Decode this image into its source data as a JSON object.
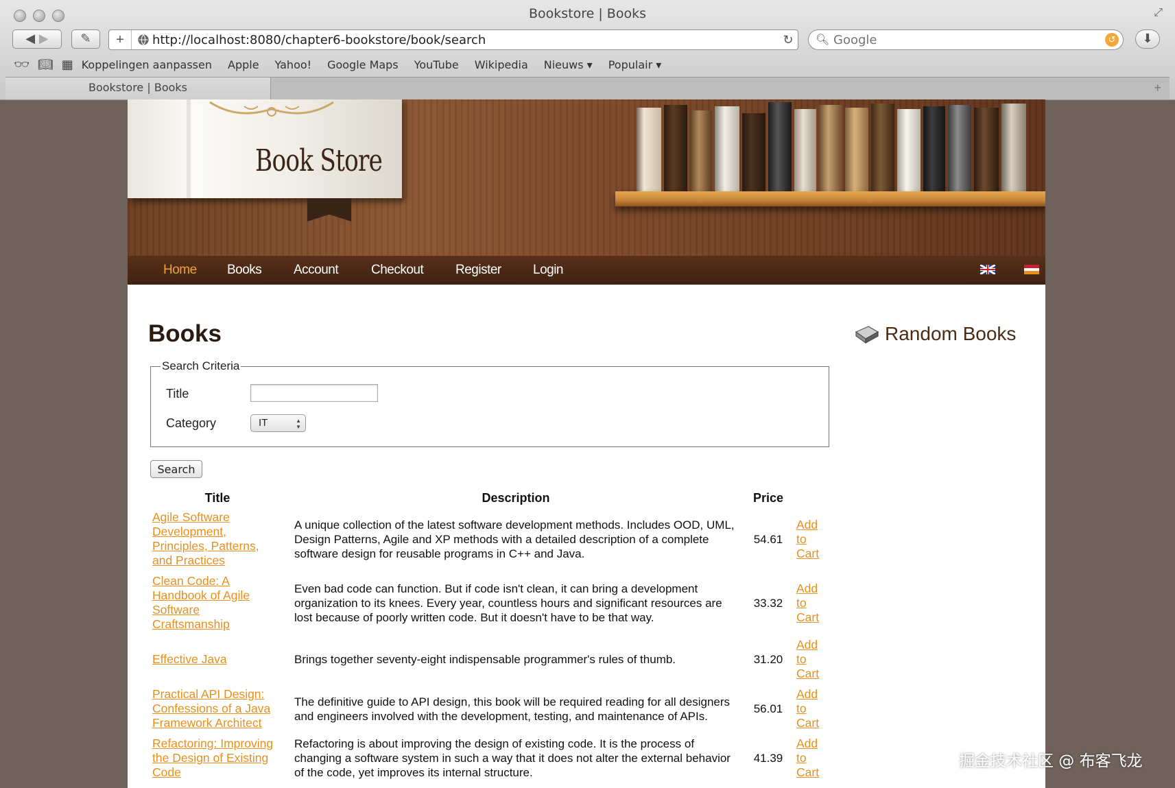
{
  "window": {
    "title": "Bookstore | Books"
  },
  "toolbar": {
    "back": "◀",
    "forward": "▶",
    "url": "http://localhost:8080/chapter6-bookstore/book/search",
    "search_placeholder": "Google"
  },
  "bookmarks": [
    "Koppelingen aanpassen",
    "Apple",
    "Yahoo!",
    "Google Maps",
    "YouTube",
    "Wikipedia",
    "Nieuws ▾",
    "Populair ▾"
  ],
  "tab": {
    "label": "Bookstore | Books"
  },
  "site": {
    "logo": "Book Store",
    "nav": [
      "Home",
      "Books",
      "Account",
      "Checkout",
      "Register",
      "Login"
    ],
    "accent": "#e8901f",
    "nav_active_color": "#f2a23a"
  },
  "main": {
    "title": "Books",
    "sidebar_title": "Random Books",
    "criteria": {
      "legend": "Search Criteria",
      "title_label": "Title",
      "title_value": "",
      "category_label": "Category",
      "category_value": "IT"
    },
    "search_label": "Search",
    "table": {
      "headers": [
        "Title",
        "Description",
        "Price"
      ],
      "rows": [
        {
          "title": "Agile Software Development, Principles, Patterns, and Practices",
          "description": "A unique collection of the latest software development methods. Includes OOD, UML, Design Patterns, Agile and XP methods with a detailed description of a complete software design for reusable programs in C++ and Java.",
          "price": "54.61",
          "cart": [
            "Add",
            "to",
            "Cart"
          ]
        },
        {
          "title": "Clean Code: A Handbook of Agile Software Craftsmanship",
          "description": "Even bad code can function. But if code isn't clean, it can bring a development organization to its knees. Every year, countless hours and significant resources are lost because of poorly written code. But it doesn't have to be that way.",
          "price": "33.32",
          "cart": [
            "Add",
            "to",
            "Cart"
          ]
        },
        {
          "title": "Effective Java",
          "description": "Brings together seventy-eight indispensable programmer's rules of thumb.",
          "price": "31.20",
          "cart": [
            "Add",
            "to",
            "Cart"
          ]
        },
        {
          "title": "Practical API Design: Confessions of a Java Framework Architect",
          "description": "The definitive guide to API design, this book will be required reading for all designers and engineers involved with the development, testing, and maintenance of APIs.",
          "price": "56.01",
          "cart": [
            "Add",
            "to",
            "Cart"
          ]
        },
        {
          "title": "Refactoring: Improving the Design of Existing Code",
          "description": "Refactoring is about improving the design of existing code. It is the process of changing a software system in such a way that it does not alter the external behavior of the code, yet improves its internal structure.",
          "price": "41.39",
          "cart": [
            "Add",
            "to",
            "Cart"
          ]
        }
      ]
    }
  },
  "watermark": "掘金技术社区 @ 布客飞龙"
}
